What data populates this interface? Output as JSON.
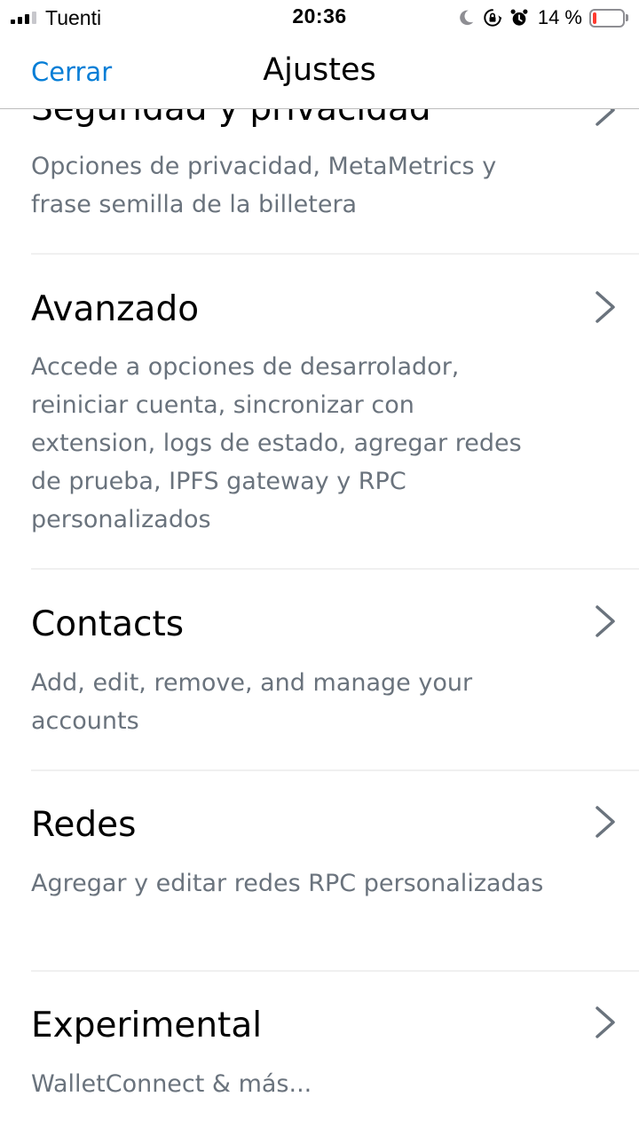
{
  "status_bar": {
    "carrier": "Tuenti",
    "time": "20:36",
    "battery_percent": "14 %",
    "battery_level": 0.14,
    "icons": [
      "signal-icon",
      "moon-icon",
      "rotation-lock-icon",
      "alarm-icon",
      "battery-icon"
    ]
  },
  "header": {
    "close_label": "Cerrar",
    "title": "Ajustes"
  },
  "settings": [
    {
      "title": "Seguridad y privacidad",
      "description": "Opciones de privacidad, MetaMetrics y frase semilla de la billetera"
    },
    {
      "title": "Avanzado",
      "description": "Accede a opciones de desarrolador, reiniciar cuenta, sincronizar con extension, logs de estado, agregar redes de prueba, IPFS gateway y RPC personalizados"
    },
    {
      "title": "Contacts",
      "description": "Add, edit, remove, and manage your accounts"
    },
    {
      "title": "Redes",
      "description": "Agregar y editar redes RPC personalizadas"
    },
    {
      "title": "Experimental",
      "description": "WalletConnect & más..."
    }
  ],
  "colors": {
    "accent": "#037dd6",
    "description_text": "#6a737d",
    "chevron": "#6a737d",
    "battery_low": "#ff3b30"
  }
}
